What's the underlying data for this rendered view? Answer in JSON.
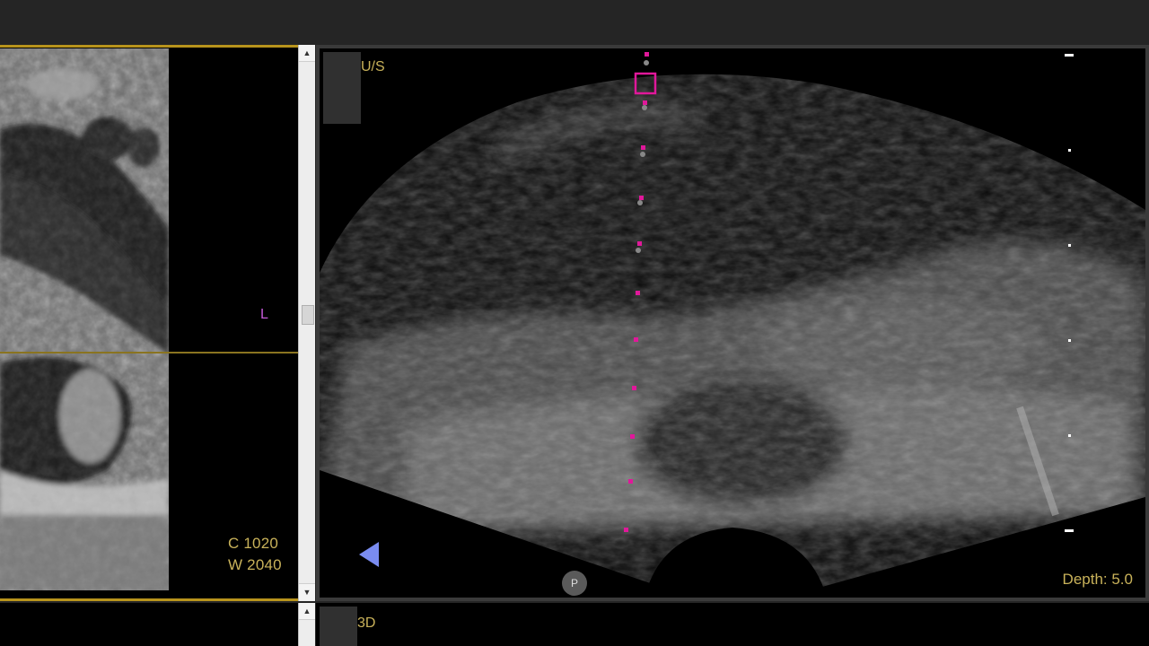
{
  "mri_view": {
    "orientation_marker": "L",
    "window_center": "C 1020",
    "window_width": "W 2040"
  },
  "us_view": {
    "label": "U/S",
    "depth": "Depth: 5.0",
    "overlay_color": "#e0189a",
    "probe_marker": "P"
  },
  "threed_view": {
    "label": "3D"
  },
  "scrollbar": {
    "up_arrow": "▲",
    "down_arrow": "▼"
  }
}
